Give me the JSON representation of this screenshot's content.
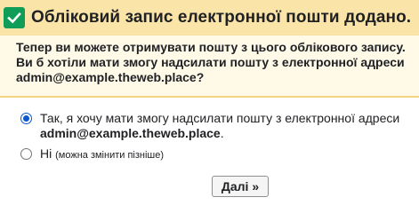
{
  "header": {
    "title": "Обліковий запис електронної пошти додано.",
    "icon": "check-icon",
    "icon_color": "#0f9d58",
    "background": "#fae4a7"
  },
  "intro": {
    "line1": "Тепер ви можете отримувати пошту з цього облікового запису.",
    "line2": "Ви б хотіли мати змогу надсилати пошту з електронної адреси",
    "line3": "admin@example.theweb.place?"
  },
  "options": {
    "yes": {
      "line1": "Так, я хочу мати змогу надсилати пошту з електронної адреси",
      "email": "admin@example.theweb.place",
      "period": ".",
      "checked": true
    },
    "no": {
      "label": "Ні",
      "note": "(можна змінити пізніше)",
      "checked": false
    }
  },
  "buttons": {
    "next": "Далі »"
  }
}
